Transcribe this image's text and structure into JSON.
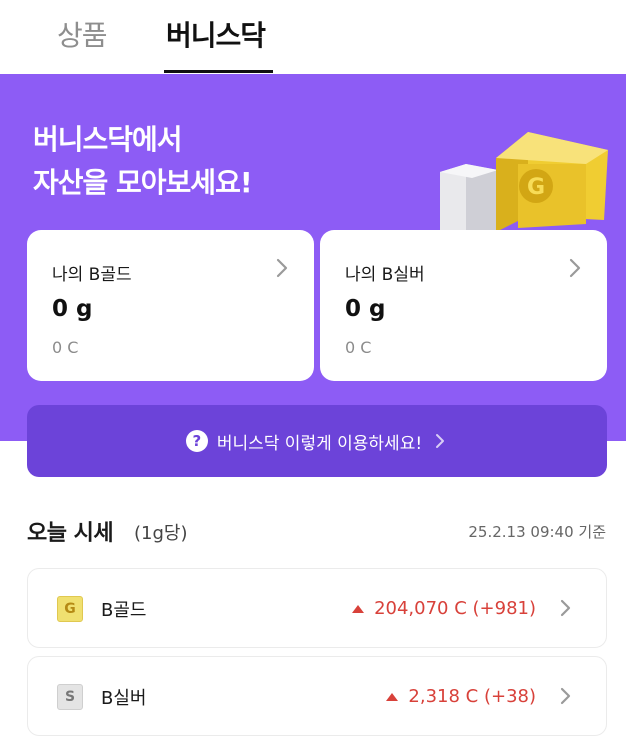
{
  "tabs": [
    {
      "label": "상품",
      "active": false
    },
    {
      "label": "버니스닥",
      "active": true
    }
  ],
  "hero": {
    "title_line1": "버니스닥에서",
    "title_line2": "자산을 모아보세요!",
    "background": "#8d5cf5"
  },
  "assets": [
    {
      "name": "나의 B골드",
      "weight": "0 g",
      "coin": "0 C"
    },
    {
      "name": "나의 B실버",
      "weight": "0 g",
      "coin": "0 C"
    }
  ],
  "guide_button": {
    "label": "버니스닥 이렇게 이용하세요!",
    "icon": "question-icon",
    "color": "#6c43d9"
  },
  "market": {
    "title": "오늘 시세",
    "unit": "(1g당)",
    "timestamp": "25.2.13 09:40 기준",
    "rows": [
      {
        "badge": "G",
        "name": "B골드",
        "price": "204,070 C (+981)",
        "trend": "up"
      },
      {
        "badge": "S",
        "name": "B실버",
        "price": "2,318 C (+38)",
        "trend": "up"
      }
    ],
    "up_color": "#d8413a"
  }
}
